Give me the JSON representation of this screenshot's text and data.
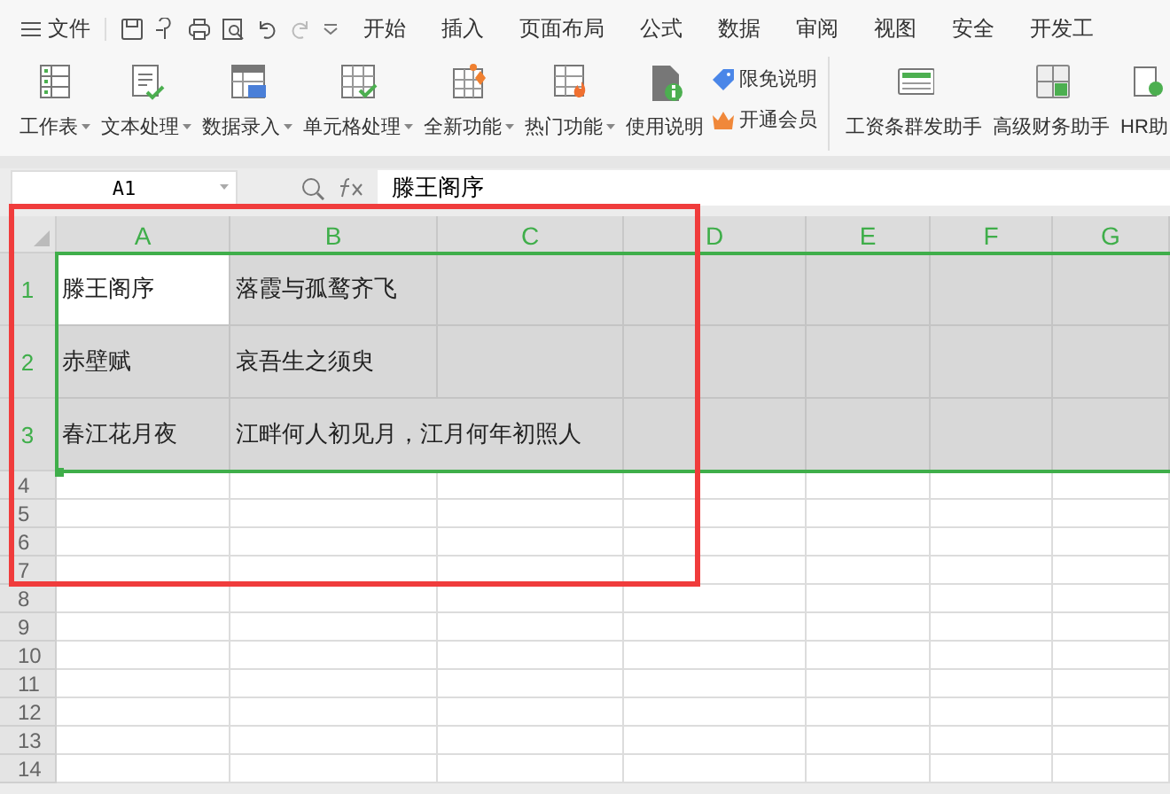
{
  "menu": {
    "file": "文件",
    "tabs": [
      {
        "label": "开始",
        "selected": false
      },
      {
        "label": "插入",
        "selected": false
      },
      {
        "label": "页面布局",
        "selected": false
      },
      {
        "label": "公式",
        "selected": false
      },
      {
        "label": "数据",
        "selected": false
      },
      {
        "label": "审阅",
        "selected": false
      },
      {
        "label": "视图",
        "selected": false
      },
      {
        "label": "安全",
        "selected": false
      },
      {
        "label": "开发工",
        "selected": false
      }
    ]
  },
  "ribbon": {
    "tools": [
      {
        "label": "工作表",
        "dropdown": true
      },
      {
        "label": "文本处理",
        "dropdown": true
      },
      {
        "label": "数据录入",
        "dropdown": true
      },
      {
        "label": "单元格处理",
        "dropdown": true
      },
      {
        "label": "全新功能",
        "dropdown": true
      },
      {
        "label": "热门功能",
        "dropdown": true
      },
      {
        "label": "使用说明",
        "dropdown": false
      }
    ],
    "links": [
      "限免说明",
      "开通会员"
    ],
    "assistants": [
      "工资条群发助手",
      "高级财务助手",
      "HR助"
    ]
  },
  "formula_bar": {
    "name_box": "A1",
    "formula": "滕王阁序"
  },
  "sheet": {
    "columns": [
      {
        "label": "A",
        "selected": true
      },
      {
        "label": "B",
        "selected": true
      },
      {
        "label": "C",
        "selected": true
      },
      {
        "label": "D",
        "selected": true
      },
      {
        "label": "E",
        "selected": true
      },
      {
        "label": "F",
        "selected": true
      },
      {
        "label": "G",
        "selected": true
      }
    ],
    "rows": [
      {
        "header": "1",
        "selected": true,
        "cells": [
          {
            "text": "滕王阁序",
            "active": true
          },
          {
            "text": "落霞与孤鹜齐飞",
            "active": false
          }
        ]
      },
      {
        "header": "2",
        "selected": true,
        "cells": [
          {
            "text": "赤壁赋",
            "active": false
          },
          {
            "text": "哀吾生之须臾",
            "active": false
          }
        ]
      },
      {
        "header": "3",
        "selected": true,
        "cells": [
          {
            "text": "春江花月夜",
            "active": false
          },
          {
            "text": "江畔何人初见月，江月何年初照人",
            "active": false
          }
        ]
      },
      {
        "header": "4",
        "selected": false
      },
      {
        "header": "5",
        "selected": false
      },
      {
        "header": "6",
        "selected": false
      },
      {
        "header": "7",
        "selected": false
      },
      {
        "header": "8",
        "selected": false
      },
      {
        "header": "9",
        "selected": false
      },
      {
        "header": "10",
        "selected": false
      },
      {
        "header": "11",
        "selected": false
      },
      {
        "header": "12",
        "selected": false
      },
      {
        "header": "13",
        "selected": false
      },
      {
        "header": "14",
        "selected": false
      }
    ]
  }
}
